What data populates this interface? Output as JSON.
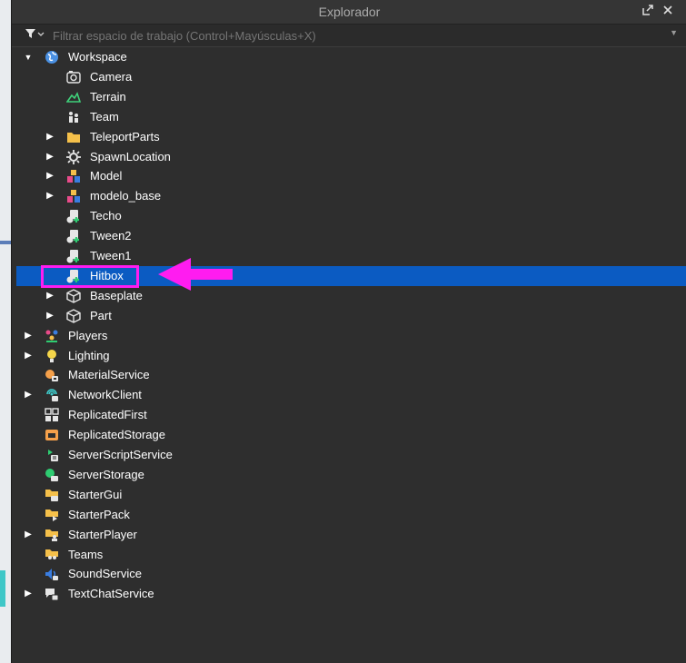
{
  "window": {
    "title": "Explorador",
    "popout_icon": "popout-icon",
    "close_icon": "close-icon"
  },
  "filter": {
    "placeholder": "Filtrar espacio de trabajo (Control+Mayúsculas+X)",
    "icon": "filter-icon"
  },
  "tree": [
    {
      "label": "Workspace",
      "icon": "globe-icon",
      "expandable": true,
      "expanded": true,
      "depth": 0
    },
    {
      "label": "Camera",
      "icon": "camera-icon",
      "expandable": false,
      "depth": 1
    },
    {
      "label": "Terrain",
      "icon": "terrain-icon",
      "expandable": false,
      "depth": 1
    },
    {
      "label": "Team",
      "icon": "team-icon",
      "expandable": false,
      "depth": 1
    },
    {
      "label": "TeleportParts",
      "icon": "folder-icon",
      "expandable": true,
      "depth": 1
    },
    {
      "label": "SpawnLocation",
      "icon": "spawn-gear-icon",
      "expandable": true,
      "depth": 1
    },
    {
      "label": "Model",
      "icon": "model-icon",
      "expandable": true,
      "depth": 1
    },
    {
      "label": "modelo_base",
      "icon": "model-icon",
      "expandable": true,
      "depth": 1
    },
    {
      "label": "Techo",
      "icon": "script-icon",
      "expandable": false,
      "depth": 1
    },
    {
      "label": "Tween2",
      "icon": "script-icon",
      "expandable": false,
      "depth": 1
    },
    {
      "label": "Tween1",
      "icon": "script-icon",
      "expandable": false,
      "depth": 1
    },
    {
      "label": "Hitbox",
      "icon": "script-icon",
      "expandable": false,
      "depth": 1,
      "selected": true
    },
    {
      "label": "Baseplate",
      "icon": "part-icon",
      "expandable": true,
      "depth": 1
    },
    {
      "label": "Part",
      "icon": "part-icon",
      "expandable": true,
      "depth": 1
    },
    {
      "label": "Players",
      "icon": "players-icon",
      "expandable": true,
      "depth": 0
    },
    {
      "label": "Lighting",
      "icon": "lightbulb-icon",
      "expandable": true,
      "depth": 0
    },
    {
      "label": "MaterialService",
      "icon": "material-service-icon",
      "expandable": false,
      "depth": 0
    },
    {
      "label": "NetworkClient",
      "icon": "network-icon",
      "expandable": true,
      "depth": 0
    },
    {
      "label": "ReplicatedFirst",
      "icon": "replicated-first-icon",
      "expandable": false,
      "depth": 0
    },
    {
      "label": "ReplicatedStorage",
      "icon": "replicated-storage-icon",
      "expandable": false,
      "depth": 0
    },
    {
      "label": "ServerScriptService",
      "icon": "server-script-icon",
      "expandable": false,
      "depth": 0
    },
    {
      "label": "ServerStorage",
      "icon": "server-storage-icon",
      "expandable": false,
      "depth": 0
    },
    {
      "label": "StarterGui",
      "icon": "starter-gui-icon",
      "expandable": false,
      "depth": 0
    },
    {
      "label": "StarterPack",
      "icon": "starter-pack-icon",
      "expandable": false,
      "depth": 0
    },
    {
      "label": "StarterPlayer",
      "icon": "starter-player-icon",
      "expandable": true,
      "depth": 0
    },
    {
      "label": "Teams",
      "icon": "teams-icon",
      "expandable": false,
      "depth": 0
    },
    {
      "label": "SoundService",
      "icon": "sound-icon",
      "expandable": false,
      "depth": 0
    },
    {
      "label": "TextChatService",
      "icon": "chat-icon",
      "expandable": true,
      "depth": 0
    }
  ],
  "colors": {
    "selection": "#0b5bc2",
    "highlight": "#ff1cf0",
    "background": "#2e2e2e"
  }
}
